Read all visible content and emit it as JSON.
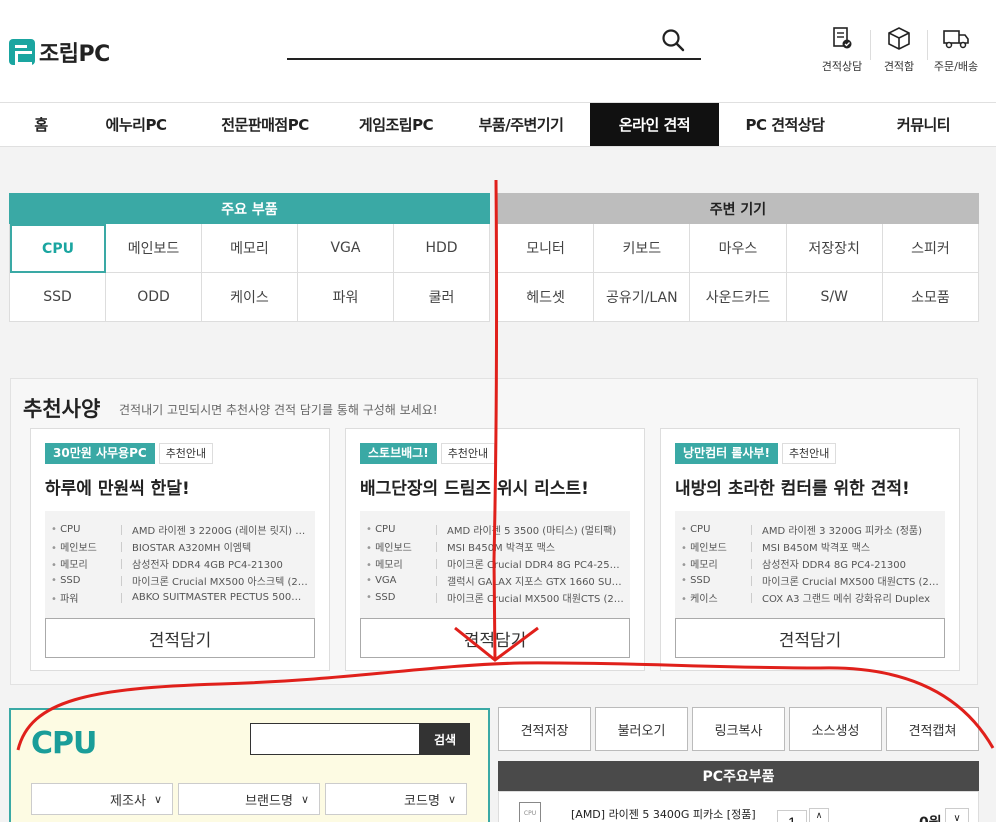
{
  "brand": {
    "logo_text": "조립PC"
  },
  "search": {
    "placeholder": ""
  },
  "header_icons": [
    {
      "label": "견적상담",
      "icon": "estimate-consult-icon"
    },
    {
      "label": "견적함",
      "icon": "box-icon"
    },
    {
      "label": "주문/배송",
      "icon": "truck-icon"
    }
  ],
  "nav": [
    {
      "label": "홈",
      "active": false
    },
    {
      "label": "에누리PC",
      "active": false
    },
    {
      "label": "전문판매점PC",
      "active": false
    },
    {
      "label": "게임조립PC",
      "active": false
    },
    {
      "label": "부품/주변기기",
      "active": false
    },
    {
      "label": "온라인 견적",
      "active": true
    },
    {
      "label": "PC 견적상담",
      "active": false
    },
    {
      "label": "커뮤니티",
      "active": false
    }
  ],
  "main_parts": {
    "title": "주요 부품",
    "items": [
      "CPU",
      "메인보드",
      "메모리",
      "VGA",
      "HDD",
      "SSD",
      "ODD",
      "케이스",
      "파워",
      "쿨러"
    ],
    "selected": "CPU"
  },
  "peripherals": {
    "title": "주변 기기",
    "items": [
      "모니터",
      "키보드",
      "마우스",
      "저장장치",
      "스피커",
      "헤드셋",
      "공유기/LAN",
      "사운드카드",
      "S/W",
      "소모품"
    ]
  },
  "recommend": {
    "title": "추천사양",
    "subtitle": "견적내기 고민되시면 추천사양 견적 담기를 통해 구성해 보세요!",
    "button_label": "견적담기",
    "cards": [
      {
        "badge": "30만원 사무용PC",
        "tag": "추천안내",
        "heading": "하루에 만원씩 한달!",
        "specs": [
          {
            "k": "CPU",
            "v": "AMD 라이젠 3 2200G (레이븐 릿지) (정..."
          },
          {
            "k": "메인보드",
            "v": "BIOSTAR A320MH 이엠텍"
          },
          {
            "k": "메모리",
            "v": "삼성전자 DDR4 4GB PC4-21300"
          },
          {
            "k": "SSD",
            "v": "마이크론 Crucial MX500 아스크텍 (250GB)"
          },
          {
            "k": "파워",
            "v": "ABKO SUITMASTER PECTUS 500W Active..."
          }
        ]
      },
      {
        "badge": "스토브배그!",
        "tag": "추천안내",
        "heading": "배그단장의 드림즈 위시 리스트!",
        "specs": [
          {
            "k": "CPU",
            "v": "AMD 라이젠 5 3500 (마티스) (멀티팩)"
          },
          {
            "k": "메인보드",
            "v": "MSI B450M 박격포 맥스"
          },
          {
            "k": "메모리",
            "v": "마이크론 Crucial DDR4 8G PC4-25600 C..."
          },
          {
            "k": "VGA",
            "v": "갤럭시 GALAX 지포스 GTX 1660 SUPER ..."
          },
          {
            "k": "SSD",
            "v": "마이크론 Crucial MX500 대원CTS (250GB)"
          }
        ]
      },
      {
        "badge": "낭만컴터 롤사부!",
        "tag": "추천안내",
        "heading": "내방의 초라한 컴터를 위한 견적!",
        "specs": [
          {
            "k": "CPU",
            "v": "AMD 라이젠 3 3200G 피카소 (정품)"
          },
          {
            "k": "메인보드",
            "v": "MSI B450M 박격포 맥스"
          },
          {
            "k": "메모리",
            "v": "삼성전자 DDR4 8G PC4-21300"
          },
          {
            "k": "SSD",
            "v": "마이크론 Crucial MX500 대원CTS (250GB)"
          },
          {
            "k": "케이스",
            "v": "COX A3 그랜드 메쉬 강화유리 Duplex"
          }
        ]
      }
    ]
  },
  "cpu_panel": {
    "title": "CPU",
    "search_button": "검색",
    "filters": [
      "제조사",
      "브랜드명",
      "코드명"
    ]
  },
  "tools": [
    "견적저장",
    "불러오기",
    "링크복사",
    "소스생성",
    "견적캡쳐"
  ],
  "pc_parts": {
    "title": "PC주요부품",
    "rows": [
      {
        "icon": "cpu-chip-icon",
        "icon_label": "CPU",
        "name": "[AMD] 라이젠 5 3400G 피카소 [정품]",
        "qty": "1",
        "price": "0원"
      }
    ]
  },
  "annotation_color": "#e0201b"
}
